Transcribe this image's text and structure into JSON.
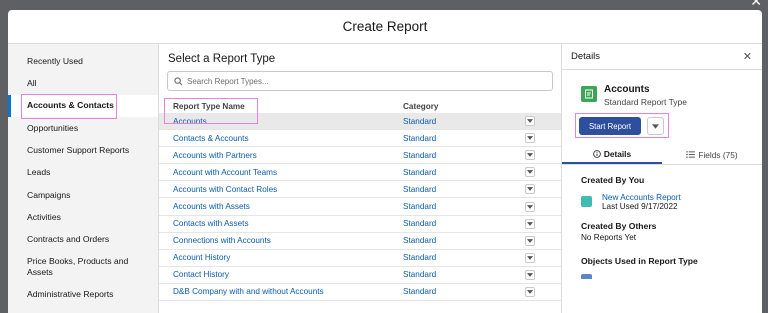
{
  "modal": {
    "title": "Create Report",
    "close_glyph": "✕"
  },
  "categories": [
    {
      "label": "Recently Used",
      "active": false
    },
    {
      "label": "All",
      "active": false
    },
    {
      "label": "Accounts & Contacts",
      "active": true
    },
    {
      "label": "Opportunities",
      "active": false
    },
    {
      "label": "Customer Support Reports",
      "active": false
    },
    {
      "label": "Leads",
      "active": false
    },
    {
      "label": "Campaigns",
      "active": false
    },
    {
      "label": "Activities",
      "active": false
    },
    {
      "label": "Contracts and Orders",
      "active": false
    },
    {
      "label": "Price Books, Products and Assets",
      "active": false
    },
    {
      "label": "Administrative Reports",
      "active": false
    }
  ],
  "report_types": {
    "title": "Select a Report Type",
    "search_placeholder": "Search Report Types...",
    "col_name": "Report Type Name",
    "col_category": "Category",
    "rows": [
      {
        "name": "Accounts",
        "category": "Standard"
      },
      {
        "name": "Contacts & Accounts",
        "category": "Standard"
      },
      {
        "name": "Accounts with Partners",
        "category": "Standard"
      },
      {
        "name": "Account with Account Teams",
        "category": "Standard"
      },
      {
        "name": "Accounts with Contact Roles",
        "category": "Standard"
      },
      {
        "name": "Accounts with Assets",
        "category": "Standard"
      },
      {
        "name": "Contacts with Assets",
        "category": "Standard"
      },
      {
        "name": "Connections with Accounts",
        "category": "Standard"
      },
      {
        "name": "Account History",
        "category": "Standard"
      },
      {
        "name": "Contact History",
        "category": "Standard"
      },
      {
        "name": "D&B Company with and without Accounts",
        "category": "Standard"
      }
    ]
  },
  "details": {
    "title": "Details",
    "close_glyph": "✕",
    "name": "Accounts",
    "type": "Standard Report Type",
    "start_button": "Start Report",
    "tab_details": "Details",
    "tab_fields": "Fields (75)",
    "created_by_you": "Created By You",
    "report_link": "New Accounts Report",
    "last_used": "Last Used 9/17/2022",
    "created_by_others": "Created By Others",
    "no_reports": "No Reports Yet",
    "objects_used": "Objects Used in Report Type"
  },
  "colors": {
    "accent": "#2e4f9e",
    "highlight": "#e583e0",
    "icon_green": "#3ba755"
  }
}
